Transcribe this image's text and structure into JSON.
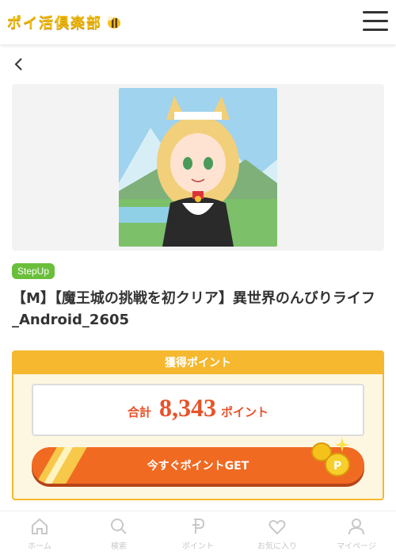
{
  "header": {
    "logo_text": "ポイ活倶楽部",
    "menu_icon": "hamburger-menu-icon"
  },
  "nav_back_icon": "chevron-left-icon",
  "offer": {
    "image_alt": "character-illustration",
    "badge": "StepUp",
    "title": "【M】【魔王城の挑戦を初クリア】異世界のんびりライフ_Android_2605"
  },
  "points": {
    "heading": "獲得ポイント",
    "total_label": "合計",
    "total_value": "8,343",
    "unit": "ポイント",
    "cta_label": "今すぐポイントGET"
  },
  "footer": {
    "items": [
      {
        "label": "ホーム",
        "icon": "home-icon"
      },
      {
        "label": "検索",
        "icon": "search-icon"
      },
      {
        "label": "ポイント",
        "icon": "points-icon"
      },
      {
        "label": "お気に入り",
        "icon": "heart-icon"
      },
      {
        "label": "マイページ",
        "icon": "user-icon"
      }
    ]
  },
  "colors": {
    "brand_yellow": "#f5b82e",
    "accent_orange": "#f06a22",
    "points_red": "#e8522a",
    "badge_green": "#6abf3a"
  }
}
